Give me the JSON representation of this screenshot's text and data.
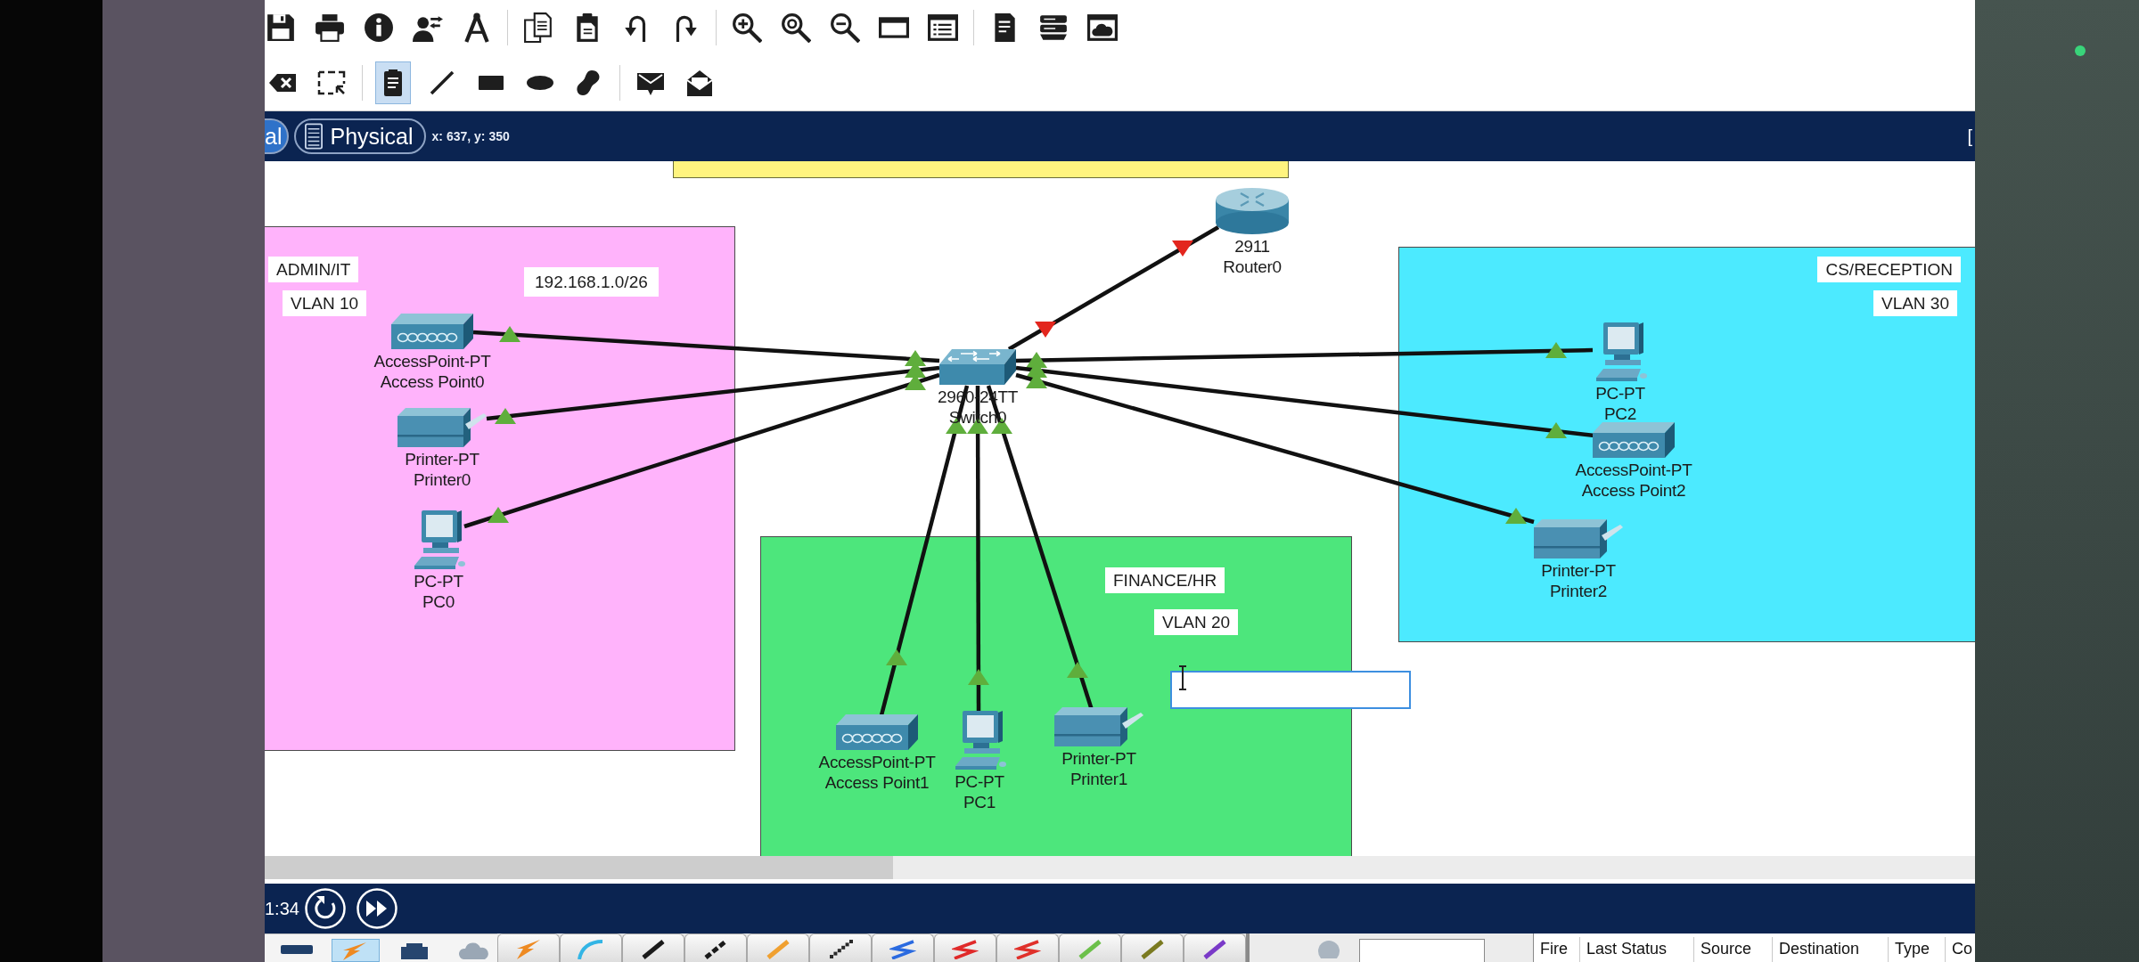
{
  "toolbar": {
    "main": [
      [
        {
          "kind": "save"
        },
        {
          "kind": "print"
        },
        {
          "kind": "info"
        },
        {
          "kind": "user"
        },
        {
          "kind": "wizard"
        }
      ],
      [
        {
          "kind": "copy"
        },
        {
          "kind": "paste"
        },
        {
          "kind": "undo"
        },
        {
          "kind": "redo"
        }
      ],
      [
        {
          "kind": "zoomin"
        },
        {
          "kind": "zoomreset"
        },
        {
          "kind": "zoomout"
        },
        {
          "kind": "window"
        },
        {
          "kind": "palette"
        }
      ],
      [
        {
          "kind": "document"
        },
        {
          "kind": "rack"
        },
        {
          "kind": "cloud"
        }
      ]
    ],
    "edit": [
      [
        {
          "kind": "delete",
          "selected": false
        },
        {
          "kind": "select",
          "selected": false
        }
      ],
      [
        {
          "kind": "note",
          "selected": true
        },
        {
          "kind": "line",
          "selected": false
        },
        {
          "kind": "rectangle",
          "selected": false
        },
        {
          "kind": "ellipse",
          "selected": false
        },
        {
          "kind": "freeform",
          "selected": false
        }
      ],
      [
        {
          "kind": "pdu",
          "selected": false
        },
        {
          "kind": "complexpdu",
          "selected": false
        }
      ]
    ]
  },
  "view_bar": {
    "tabs": [
      {
        "label": "al",
        "kind": "logical",
        "selected": true
      },
      {
        "label": "Physical",
        "kind": "physical",
        "selected": false
      }
    ],
    "cursor": "x: 637, y: 350",
    "edge_text": "["
  },
  "canvas": {
    "areas": [
      {
        "title": "ADMIN/IT",
        "vlan": "VLAN 10",
        "subnet": "192.168.1.0/26",
        "color": "#ffb3fb"
      },
      {
        "title": "CS/RECEPTION",
        "vlan": "VLAN 30",
        "color": "#4ceaff"
      },
      {
        "title": "FINANCE/HR",
        "vlan": "VLAN 20",
        "color": "#4de67c"
      }
    ],
    "devices": [
      {
        "kind": "router",
        "model": "2911",
        "name": "Router0",
        "link_up": false
      },
      {
        "kind": "switch",
        "model": "2960-24TT",
        "name": "Switch0"
      },
      {
        "kind": "accesspoint",
        "model": "AccessPoint-PT",
        "name": "Access Point0",
        "link_up": true
      },
      {
        "kind": "printer",
        "model": "Printer-PT",
        "name": "Printer0",
        "link_up": true
      },
      {
        "kind": "pc",
        "model": "PC-PT",
        "name": "PC0",
        "link_up": true
      },
      {
        "kind": "pc",
        "model": "PC-PT",
        "name": "PC2",
        "link_up": true
      },
      {
        "kind": "accesspoint",
        "model": "AccessPoint-PT",
        "name": "Access Point2",
        "link_up": true
      },
      {
        "kind": "printer",
        "model": "Printer-PT",
        "name": "Printer2",
        "link_up": true
      },
      {
        "kind": "accesspoint",
        "model": "AccessPoint-PT",
        "name": "Access Point1",
        "link_up": true
      },
      {
        "kind": "pc",
        "model": "PC-PT",
        "name": "PC1",
        "link_up": true
      },
      {
        "kind": "printer",
        "model": "Printer-PT",
        "name": "Printer1",
        "link_up": true
      }
    ]
  },
  "sim_bar": {
    "time": "1:34"
  },
  "bottom_panel": {
    "categories": [
      {
        "kind": "network",
        "selected": false
      },
      {
        "kind": "connections",
        "selected": true
      },
      {
        "kind": "enddevices",
        "selected": false
      },
      {
        "kind": "components",
        "selected": false
      }
    ],
    "cables": [
      {
        "kind": "auto",
        "color": "#ee8a22"
      },
      {
        "kind": "console",
        "color": "#33b5e5"
      },
      {
        "kind": "straight",
        "color": "#1a1a1a"
      },
      {
        "kind": "cross",
        "color": "#1a1a1a"
      },
      {
        "kind": "fiber",
        "color": "#f0a030"
      },
      {
        "kind": "phone",
        "color": "#2a2a2a"
      },
      {
        "kind": "coaxial",
        "color": "#2a6ae0"
      },
      {
        "kind": "serial",
        "color": "#e02a2a"
      },
      {
        "kind": "serial",
        "color": "#e0302a"
      },
      {
        "kind": "octal",
        "color": "#6cc04a"
      },
      {
        "kind": "iot",
        "color": "#7a7a20"
      },
      {
        "kind": "usb",
        "color": "#7a3ac8"
      }
    ],
    "pdu_columns": [
      "Fire",
      "Last Status",
      "Source",
      "Destination",
      "Type",
      "Co"
    ]
  }
}
